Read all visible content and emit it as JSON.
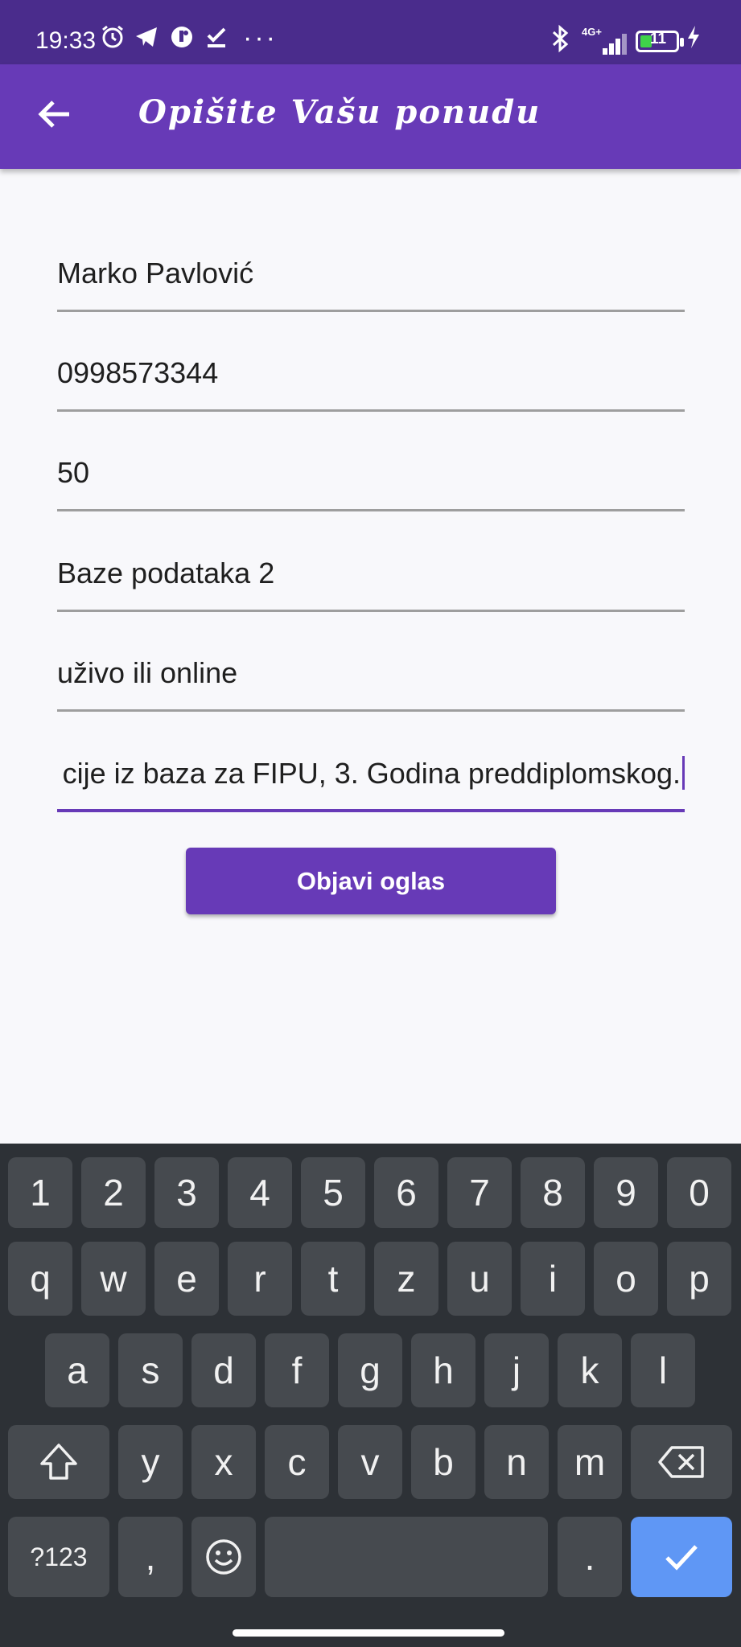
{
  "status_bar": {
    "time": "19:33",
    "icons": [
      "alarm-icon",
      "telegram-icon",
      "app-icon",
      "task-done-icon"
    ],
    "overflow": "···",
    "network": "4G+",
    "battery": "11"
  },
  "app_bar": {
    "title": "Opišite Vašu ponudu",
    "back_icon": "arrow-left-icon"
  },
  "form": {
    "fields": [
      {
        "value": "Marko Pavlović"
      },
      {
        "value": "0998573344"
      },
      {
        "value": "50"
      },
      {
        "value": "Baze podataka 2"
      },
      {
        "value": "uživo ili online"
      },
      {
        "value": "cije iz baza za FIPU, 3. Godina preddiplomskog."
      }
    ],
    "submit_label": "Objavi oglas"
  },
  "keyboard": {
    "row1": [
      "1",
      "2",
      "3",
      "4",
      "5",
      "6",
      "7",
      "8",
      "9",
      "0"
    ],
    "row2": [
      "q",
      "w",
      "e",
      "r",
      "t",
      "z",
      "u",
      "i",
      "o",
      "p"
    ],
    "row3": [
      "a",
      "s",
      "d",
      "f",
      "g",
      "h",
      "j",
      "k",
      "l"
    ],
    "row4": [
      "y",
      "x",
      "c",
      "v",
      "b",
      "n",
      "m"
    ],
    "symbols_label": "?123",
    "comma": ",",
    "period": ".",
    "accent_color": "#5f97f5"
  }
}
